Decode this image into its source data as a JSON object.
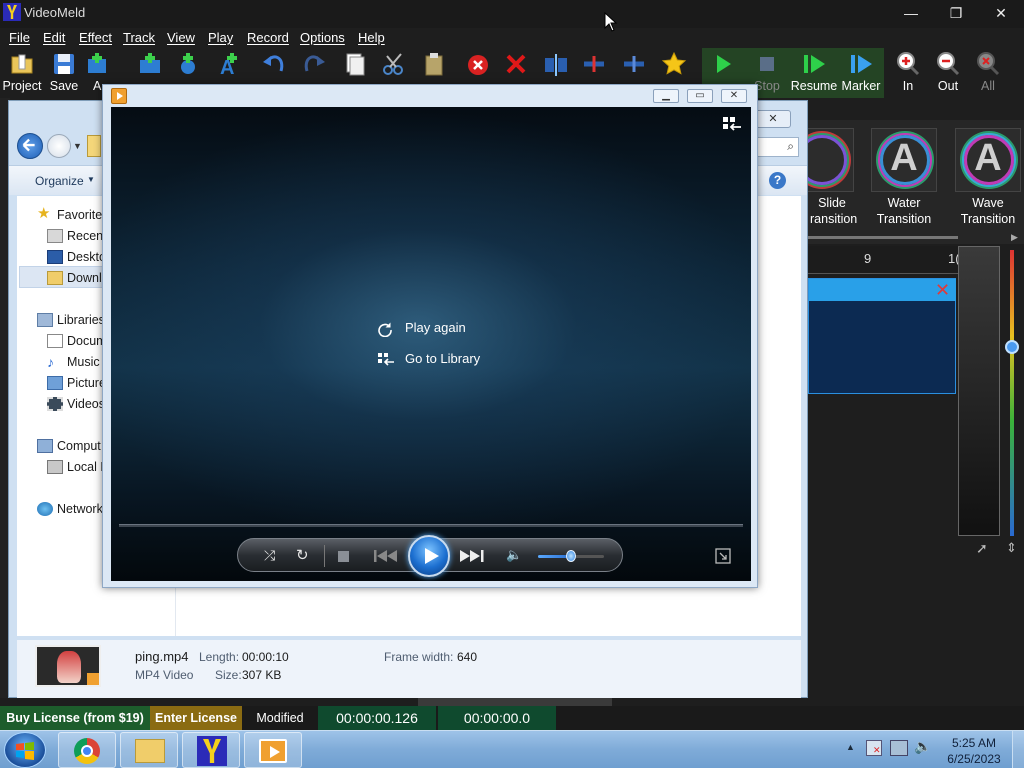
{
  "app": {
    "title": "VideoMeld",
    "menu": [
      "File",
      "Edit",
      "Effect",
      "Track",
      "View",
      "Play",
      "Record",
      "Options",
      "Help"
    ],
    "toolbar": {
      "project": "Project",
      "save": "Save",
      "add_truncated": "A",
      "stop": "Stop",
      "resume": "Resume",
      "marker": "Marker",
      "zoom_in": "In",
      "zoom_out": "Out",
      "zoom_all": "All"
    },
    "transitions": [
      {
        "label": "Slide\nTransition",
        "display": "Slide\nransition"
      },
      {
        "label": "Water\nTransition",
        "display": "Water\nTransition"
      },
      {
        "label": "Wave\nTransition",
        "display": "Wave\nTransition"
      }
    ],
    "ruler": {
      "tick_a": "9",
      "tick_b": "1("
    },
    "status": {
      "buy": "Buy License (from $19)",
      "enter": "Enter License",
      "modified": "Modified",
      "time_current": "00:00:00.126",
      "time_total": "00:00:00.0"
    },
    "colors": {
      "buy_bg": "#1d5d2c",
      "enter_bg": "#8a6b12",
      "time_bg": "#0f4a2e",
      "clip_blue": "#29a0e8"
    }
  },
  "explorer": {
    "organize": "Organize",
    "nav": {
      "favorites": "Favorites",
      "recent": "Recent",
      "desktop": "Deskto",
      "downloads": "Downl",
      "libraries": "Libraries",
      "documents": "Docum",
      "music": "Music",
      "pictures": "Picture",
      "videos": "Videos",
      "computer": "Comput",
      "local_disk": "Local D",
      "network": "Network"
    },
    "details": {
      "filename": "ping.mp4",
      "type": "MP4 Video",
      "length_label": "Length:",
      "length_value": "00:00:10",
      "size_label": "Size:",
      "size_value": "307 KB",
      "frame_width_label": "Frame width:",
      "frame_width_value": "640"
    }
  },
  "wmp": {
    "play_again": "Play again",
    "go_to_library": "Go to Library",
    "volume_level": 0.5
  },
  "taskbar": {
    "time": "5:25 AM",
    "date": "6/25/2023"
  }
}
